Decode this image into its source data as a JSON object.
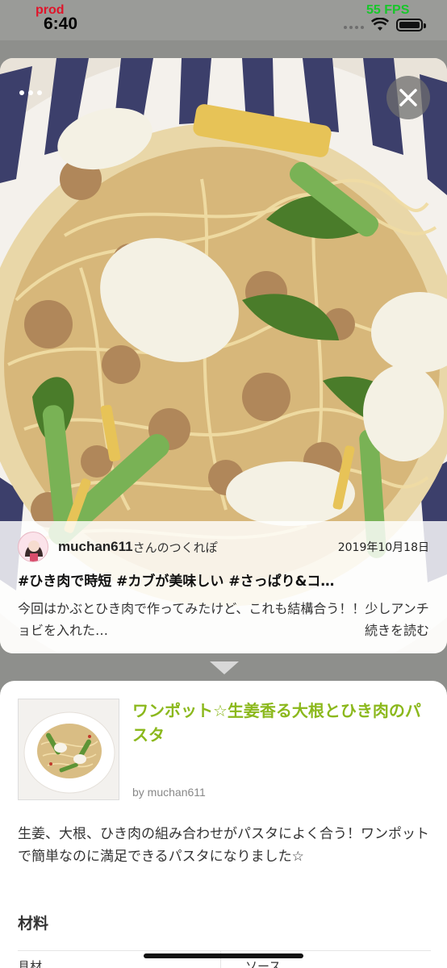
{
  "status_bar": {
    "env_label": "prod",
    "time": "6:40",
    "fps": "55 FPS"
  },
  "tsukurepo": {
    "author_name": "muchan611",
    "author_suffix": "さんのつくれぽ",
    "date": "2019年10月18日",
    "hashtags": "#ひき肉で時短 #カブが美味しい #さっぱり&コ…",
    "description": "今回はかぶとひき肉で作ってみたけど、これも結構合う！！少しアンチョビを入れた…",
    "read_more": "続きを読む"
  },
  "recipe": {
    "title": "ワンポット☆生姜香る大根とひき肉のパスタ",
    "author": "by muchan611",
    "description": "生姜、大根、ひき肉の組み合わせがパスタによく合う！ワンポットで簡単なのに満足できるパスタになりました☆",
    "ingredients_heading": "材料",
    "ingredients_col_a": "具材",
    "ingredients_col_b": "ソース"
  },
  "icons": [
    "more-icon",
    "close-icon",
    "chevron-down-icon",
    "wifi-icon",
    "battery-icon"
  ],
  "colors": {
    "accent_title": "#8bb81c",
    "prod_label": "#e0142a",
    "fps_label": "#17c72a"
  }
}
